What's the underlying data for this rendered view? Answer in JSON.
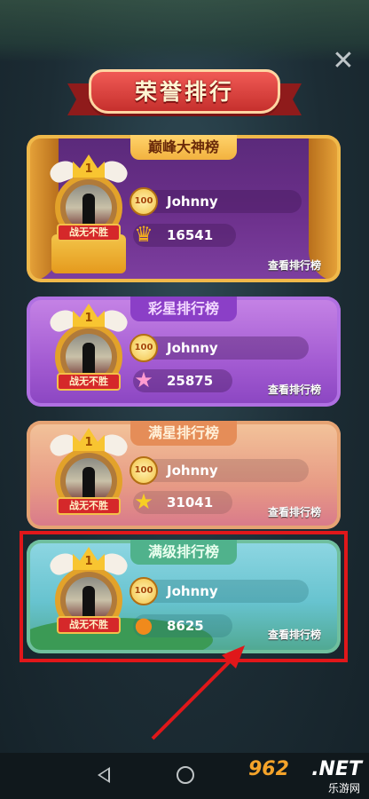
{
  "title": "荣誉排行",
  "boards": [
    {
      "name": "巅峰大神榜",
      "badge_label": "战无不胜",
      "rank": "1",
      "level": "100",
      "player": "Johnny",
      "score": "16541",
      "score_icon": "crown-icon",
      "view_label": "查看排行榜"
    },
    {
      "name": "彩星排行榜",
      "badge_label": "战无不胜",
      "rank": "1",
      "level": "100",
      "player": "Johnny",
      "score": "25875",
      "score_icon": "rainbow-star-icon",
      "view_label": "查看排行榜"
    },
    {
      "name": "满星排行榜",
      "badge_label": "战无不胜",
      "rank": "1",
      "level": "100",
      "player": "Johnny",
      "score": "31041",
      "score_icon": "star-icon",
      "view_label": "查看排行榜"
    },
    {
      "name": "满级排行榜",
      "badge_label": "战无不胜",
      "rank": "1",
      "level": "100",
      "player": "Johnny",
      "score": "8625",
      "score_icon": "sprout-icon",
      "view_label": "查看排行榜"
    }
  ],
  "highlight_color": "#e0171a",
  "watermark": {
    "logo": "962",
    "site": ".NET",
    "cn": "乐游网"
  }
}
